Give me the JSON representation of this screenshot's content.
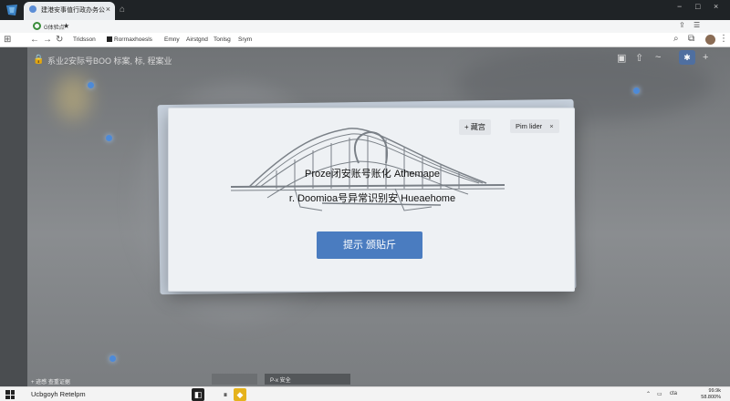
{
  "browser": {
    "tab_title": "建港安事值行政办务公",
    "tab_close": "×",
    "newtab_icon": "new-tab-icon",
    "window_minimize": "−",
    "window_maximize": "□",
    "window_close": "×"
  },
  "omnibar": {
    "url": "G体验点",
    "star": "★"
  },
  "toolbar": {
    "bookmarks": [
      "Tridsson",
      "Rorrnaxhoesls",
      "Emny",
      "Airstgnd",
      "Tonlsg",
      "Srym"
    ]
  },
  "background_page": {
    "title": "系业2安际号BOO 标案, 标, 程案业",
    "bottom_left_text": "+ 迹感 查重证据",
    "bottom_button_1": "",
    "bottom_button_2": "P-x 安全"
  },
  "modal": {
    "action_label": "+ 藏宫",
    "filter_label": "Pim lider",
    "filter_close": "×",
    "title": "Proze闭安账号账化 Athemape",
    "subtitle": "Doomioa号异常识别安 Hueaehome",
    "sub_prefix": "r.",
    "button_label": "提示 颁贴斤"
  },
  "taskbar": {
    "search_text": "Ucbgoyh Retelpm",
    "tray_lang": "cta",
    "clock_time": "99.9k",
    "clock_date": "58.800%"
  },
  "colors": {
    "modal_button": "#4a7cc0",
    "accent_blue": "#4f6fa0",
    "dot_blue": "#4d8ad8"
  }
}
